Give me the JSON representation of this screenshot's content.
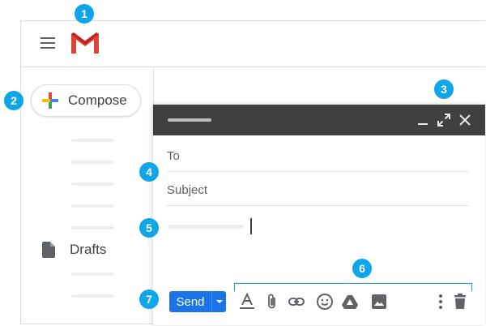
{
  "sidebar": {
    "compose_label": "Compose",
    "drafts_label": "Drafts"
  },
  "compose_window": {
    "to_label": "To",
    "subject_label": "Subject",
    "send_label": "Send"
  },
  "callouts": [
    "1",
    "2",
    "3",
    "4",
    "5",
    "6",
    "7"
  ],
  "colors": {
    "accent": "#1a73e8",
    "callout": "#0ea5e9",
    "header": "#404040",
    "gmail_red": "#db4437"
  }
}
